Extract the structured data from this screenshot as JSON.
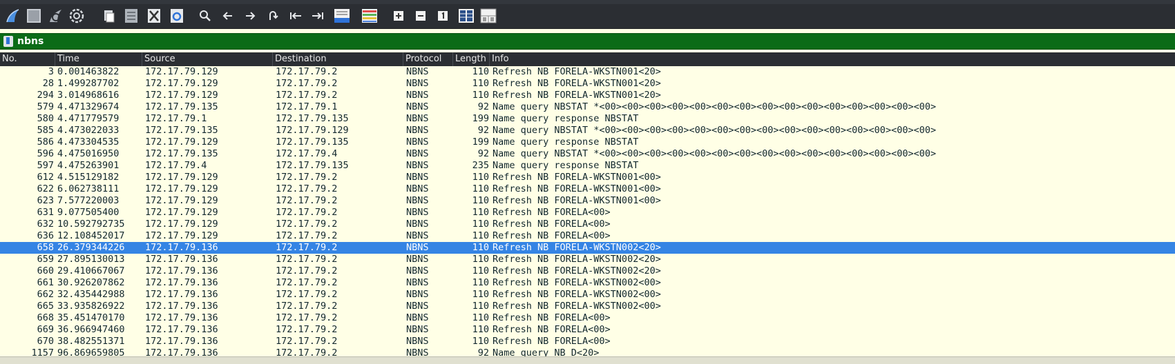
{
  "toolbar": {
    "buttons": [
      {
        "name": "shark-fin-start-icon"
      },
      {
        "name": "stop-capture-icon"
      },
      {
        "name": "restart-capture-icon"
      },
      {
        "name": "capture-options-gear-icon"
      },
      {
        "name": "open-file-icon"
      },
      {
        "name": "save-file-icon"
      },
      {
        "name": "close-file-icon"
      },
      {
        "name": "reload-file-icon"
      },
      {
        "name": "find-packet-icon"
      },
      {
        "name": "go-back-icon"
      },
      {
        "name": "go-forward-icon"
      },
      {
        "name": "go-to-packet-icon"
      },
      {
        "name": "first-packet-icon"
      },
      {
        "name": "last-packet-icon"
      },
      {
        "name": "auto-scroll-icon"
      },
      {
        "name": "colorize-icon"
      },
      {
        "name": "zoom-in-icon"
      },
      {
        "name": "zoom-out-icon"
      },
      {
        "name": "normal-size-icon"
      },
      {
        "name": "resize-columns-icon"
      },
      {
        "name": "layout-panes-icon"
      }
    ]
  },
  "filter": {
    "value": "nbns"
  },
  "columns": {
    "no": "No.",
    "time": "Time",
    "source": "Source",
    "destination": "Destination",
    "protocol": "Protocol",
    "length": "Length",
    "info": "Info"
  },
  "packets": [
    {
      "no": "3",
      "time": "0.001463822",
      "src": "172.17.79.129",
      "dst": "172.17.79.2",
      "proto": "NBNS",
      "len": "110",
      "info": "Refresh NB FORELA-WKSTN001<20>"
    },
    {
      "no": "28",
      "time": "1.499287702",
      "src": "172.17.79.129",
      "dst": "172.17.79.2",
      "proto": "NBNS",
      "len": "110",
      "info": "Refresh NB FORELA-WKSTN001<20>"
    },
    {
      "no": "294",
      "time": "3.014968616",
      "src": "172.17.79.129",
      "dst": "172.17.79.2",
      "proto": "NBNS",
      "len": "110",
      "info": "Refresh NB FORELA-WKSTN001<20>"
    },
    {
      "no": "579",
      "time": "4.471329674",
      "src": "172.17.79.135",
      "dst": "172.17.79.1",
      "proto": "NBNS",
      "len": "92",
      "info": "Name query NBSTAT *<00><00><00><00><00><00><00><00><00><00><00><00><00><00><00>"
    },
    {
      "no": "580",
      "time": "4.471779579",
      "src": "172.17.79.1",
      "dst": "172.17.79.135",
      "proto": "NBNS",
      "len": "199",
      "info": "Name query response NBSTAT"
    },
    {
      "no": "585",
      "time": "4.473022033",
      "src": "172.17.79.135",
      "dst": "172.17.79.129",
      "proto": "NBNS",
      "len": "92",
      "info": "Name query NBSTAT *<00><00><00><00><00><00><00><00><00><00><00><00><00><00><00>"
    },
    {
      "no": "586",
      "time": "4.473304535",
      "src": "172.17.79.129",
      "dst": "172.17.79.135",
      "proto": "NBNS",
      "len": "199",
      "info": "Name query response NBSTAT"
    },
    {
      "no": "596",
      "time": "4.475016950",
      "src": "172.17.79.135",
      "dst": "172.17.79.4",
      "proto": "NBNS",
      "len": "92",
      "info": "Name query NBSTAT *<00><00><00><00><00><00><00><00><00><00><00><00><00><00><00>"
    },
    {
      "no": "597",
      "time": "4.475263901",
      "src": "172.17.79.4",
      "dst": "172.17.79.135",
      "proto": "NBNS",
      "len": "235",
      "info": "Name query response NBSTAT"
    },
    {
      "no": "612",
      "time": "4.515129182",
      "src": "172.17.79.129",
      "dst": "172.17.79.2",
      "proto": "NBNS",
      "len": "110",
      "info": "Refresh NB FORELA-WKSTN001<00>"
    },
    {
      "no": "622",
      "time": "6.062738111",
      "src": "172.17.79.129",
      "dst": "172.17.79.2",
      "proto": "NBNS",
      "len": "110",
      "info": "Refresh NB FORELA-WKSTN001<00>"
    },
    {
      "no": "623",
      "time": "7.577220003",
      "src": "172.17.79.129",
      "dst": "172.17.79.2",
      "proto": "NBNS",
      "len": "110",
      "info": "Refresh NB FORELA-WKSTN001<00>"
    },
    {
      "no": "631",
      "time": "9.077505400",
      "src": "172.17.79.129",
      "dst": "172.17.79.2",
      "proto": "NBNS",
      "len": "110",
      "info": "Refresh NB FORELA<00>"
    },
    {
      "no": "632",
      "time": "10.592792735",
      "src": "172.17.79.129",
      "dst": "172.17.79.2",
      "proto": "NBNS",
      "len": "110",
      "info": "Refresh NB FORELA<00>"
    },
    {
      "no": "636",
      "time": "12.108452017",
      "src": "172.17.79.129",
      "dst": "172.17.79.2",
      "proto": "NBNS",
      "len": "110",
      "info": "Refresh NB FORELA<00>"
    },
    {
      "no": "658",
      "time": "26.379344226",
      "src": "172.17.79.136",
      "dst": "172.17.79.2",
      "proto": "NBNS",
      "len": "110",
      "info": "Refresh NB FORELA-WKSTN002<20>",
      "selected": true
    },
    {
      "no": "659",
      "time": "27.895130013",
      "src": "172.17.79.136",
      "dst": "172.17.79.2",
      "proto": "NBNS",
      "len": "110",
      "info": "Refresh NB FORELA-WKSTN002<20>"
    },
    {
      "no": "660",
      "time": "29.410667067",
      "src": "172.17.79.136",
      "dst": "172.17.79.2",
      "proto": "NBNS",
      "len": "110",
      "info": "Refresh NB FORELA-WKSTN002<20>"
    },
    {
      "no": "661",
      "time": "30.926207862",
      "src": "172.17.79.136",
      "dst": "172.17.79.2",
      "proto": "NBNS",
      "len": "110",
      "info": "Refresh NB FORELA-WKSTN002<00>"
    },
    {
      "no": "662",
      "time": "32.435442988",
      "src": "172.17.79.136",
      "dst": "172.17.79.2",
      "proto": "NBNS",
      "len": "110",
      "info": "Refresh NB FORELA-WKSTN002<00>"
    },
    {
      "no": "665",
      "time": "33.935826922",
      "src": "172.17.79.136",
      "dst": "172.17.79.2",
      "proto": "NBNS",
      "len": "110",
      "info": "Refresh NB FORELA-WKSTN002<00>"
    },
    {
      "no": "668",
      "time": "35.451470170",
      "src": "172.17.79.136",
      "dst": "172.17.79.2",
      "proto": "NBNS",
      "len": "110",
      "info": "Refresh NB FORELA<00>"
    },
    {
      "no": "669",
      "time": "36.966947460",
      "src": "172.17.79.136",
      "dst": "172.17.79.2",
      "proto": "NBNS",
      "len": "110",
      "info": "Refresh NB FORELA<00>"
    },
    {
      "no": "670",
      "time": "38.482551371",
      "src": "172.17.79.136",
      "dst": "172.17.79.2",
      "proto": "NBNS",
      "len": "110",
      "info": "Refresh NB FORELA<00>"
    },
    {
      "no": "1157",
      "time": "96.869659805",
      "src": "172.17.79.136",
      "dst": "172.17.79.2",
      "proto": "NBNS",
      "len": "92",
      "info": "Name query NB D<20>"
    }
  ]
}
